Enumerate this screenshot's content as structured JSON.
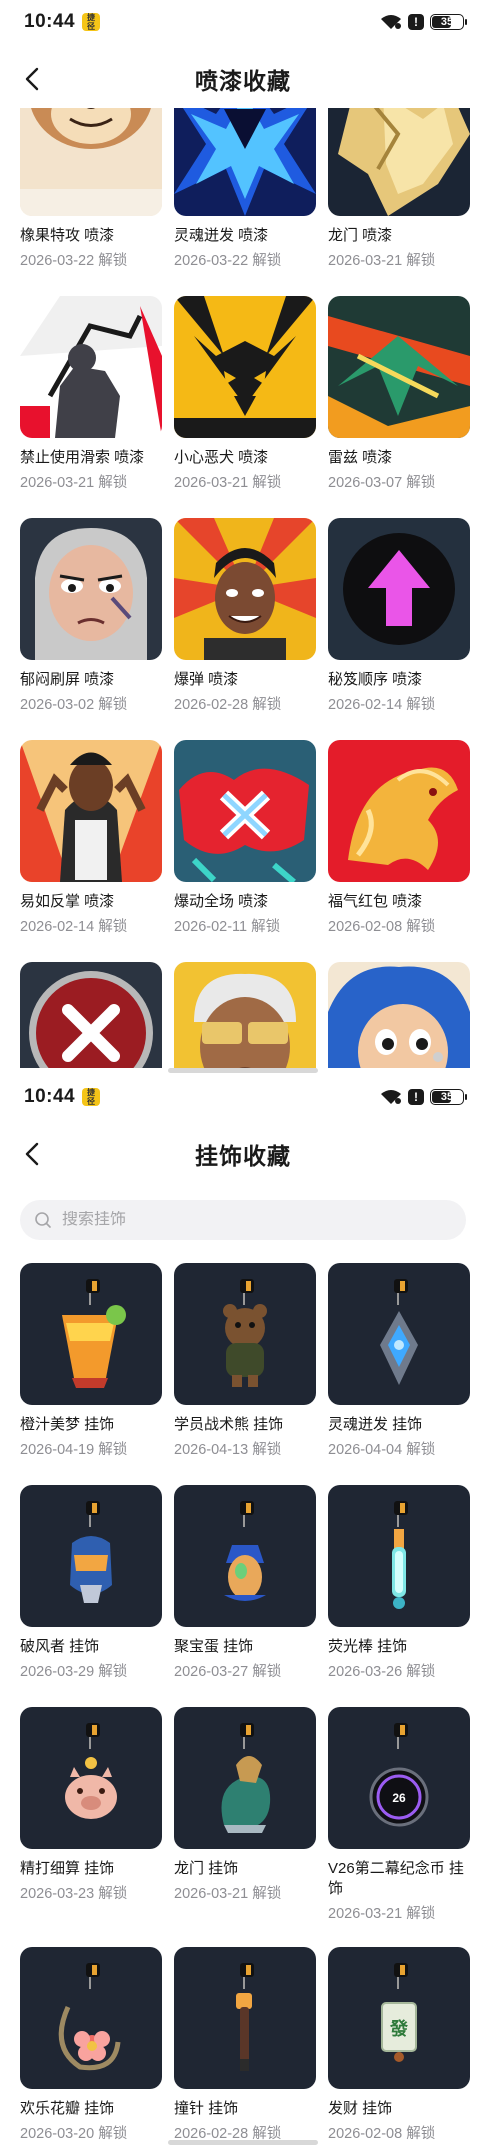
{
  "status_bar": {
    "time": "10:44",
    "battery": "35",
    "app_badge": "捷径"
  },
  "sprays_page": {
    "title": "喷漆收藏",
    "items": [
      {
        "name": "橡果特攻 喷漆",
        "date": "2026-03-22 解锁",
        "art": "squirrel"
      },
      {
        "name": "灵魂迸发 喷漆",
        "date": "2026-03-22 解锁",
        "art": "soulburst"
      },
      {
        "name": "龙门 喷漆",
        "date": "2026-03-21 解锁",
        "art": "dragongate"
      },
      {
        "name": "禁止使用滑索 喷漆",
        "date": "2026-03-21 解锁",
        "art": "zipline"
      },
      {
        "name": "小心恶犬 喷漆",
        "date": "2026-03-21 解锁",
        "art": "dog"
      },
      {
        "name": "雷兹 喷漆",
        "date": "2026-03-07 解锁",
        "art": "raze"
      },
      {
        "name": "郁闷刷屏 喷漆",
        "date": "2026-03-02 解锁",
        "art": "gloomy"
      },
      {
        "name": "爆弹 喷漆",
        "date": "2026-02-28 解锁",
        "art": "bomb"
      },
      {
        "name": "秘笈顺序 喷漆",
        "date": "2026-02-14 解锁",
        "art": "arrow"
      },
      {
        "name": "易如反掌 喷漆",
        "date": "2026-02-14 解锁",
        "art": "easy"
      },
      {
        "name": "爆动全场 喷漆",
        "date": "2026-02-11 解锁",
        "art": "graffiti"
      },
      {
        "name": "福气红包 喷漆",
        "date": "2026-02-08 解锁",
        "art": "redhorse"
      },
      {
        "name": "",
        "date": "",
        "art": "xmark"
      },
      {
        "name": "",
        "date": "",
        "art": "shades"
      },
      {
        "name": "",
        "date": "",
        "art": "bluehair"
      }
    ]
  },
  "charms_page": {
    "title": "挂饰收藏",
    "search_placeholder": "搜索挂饰",
    "items": [
      {
        "name": "橙汁美梦 挂饰",
        "date": "2026-04-19 解锁",
        "art": "juice"
      },
      {
        "name": "学员战术熊 挂饰",
        "date": "2026-04-13 解锁",
        "art": "bear"
      },
      {
        "name": "灵魂迸发 挂饰",
        "date": "2026-04-04 解锁",
        "art": "crystal"
      },
      {
        "name": "破风者 挂饰",
        "date": "2026-03-29 解锁",
        "art": "helmet"
      },
      {
        "name": "聚宝蛋 挂饰",
        "date": "2026-03-27 解锁",
        "art": "egg"
      },
      {
        "name": "荧光棒 挂饰",
        "date": "2026-03-26 解锁",
        "art": "glowstick"
      },
      {
        "name": "精打细算 挂饰",
        "date": "2026-03-23 解锁",
        "art": "piggy"
      },
      {
        "name": "龙门 挂饰",
        "date": "2026-03-21 解锁",
        "art": "dragon"
      },
      {
        "name": "V26第二幕纪念币 挂饰",
        "date": "2026-03-21 解锁",
        "art": "coin"
      },
      {
        "name": "欢乐花瓣 挂饰",
        "date": "2026-03-20 解锁",
        "art": "flower"
      },
      {
        "name": "撞针 挂饰",
        "date": "2026-02-28 解锁",
        "art": "pin"
      },
      {
        "name": "发财 挂饰",
        "date": "2026-02-08 解锁",
        "art": "mahjong"
      }
    ]
  },
  "colors": {
    "charm_bg": "#1f2633",
    "muted_text": "#8e8e93"
  }
}
